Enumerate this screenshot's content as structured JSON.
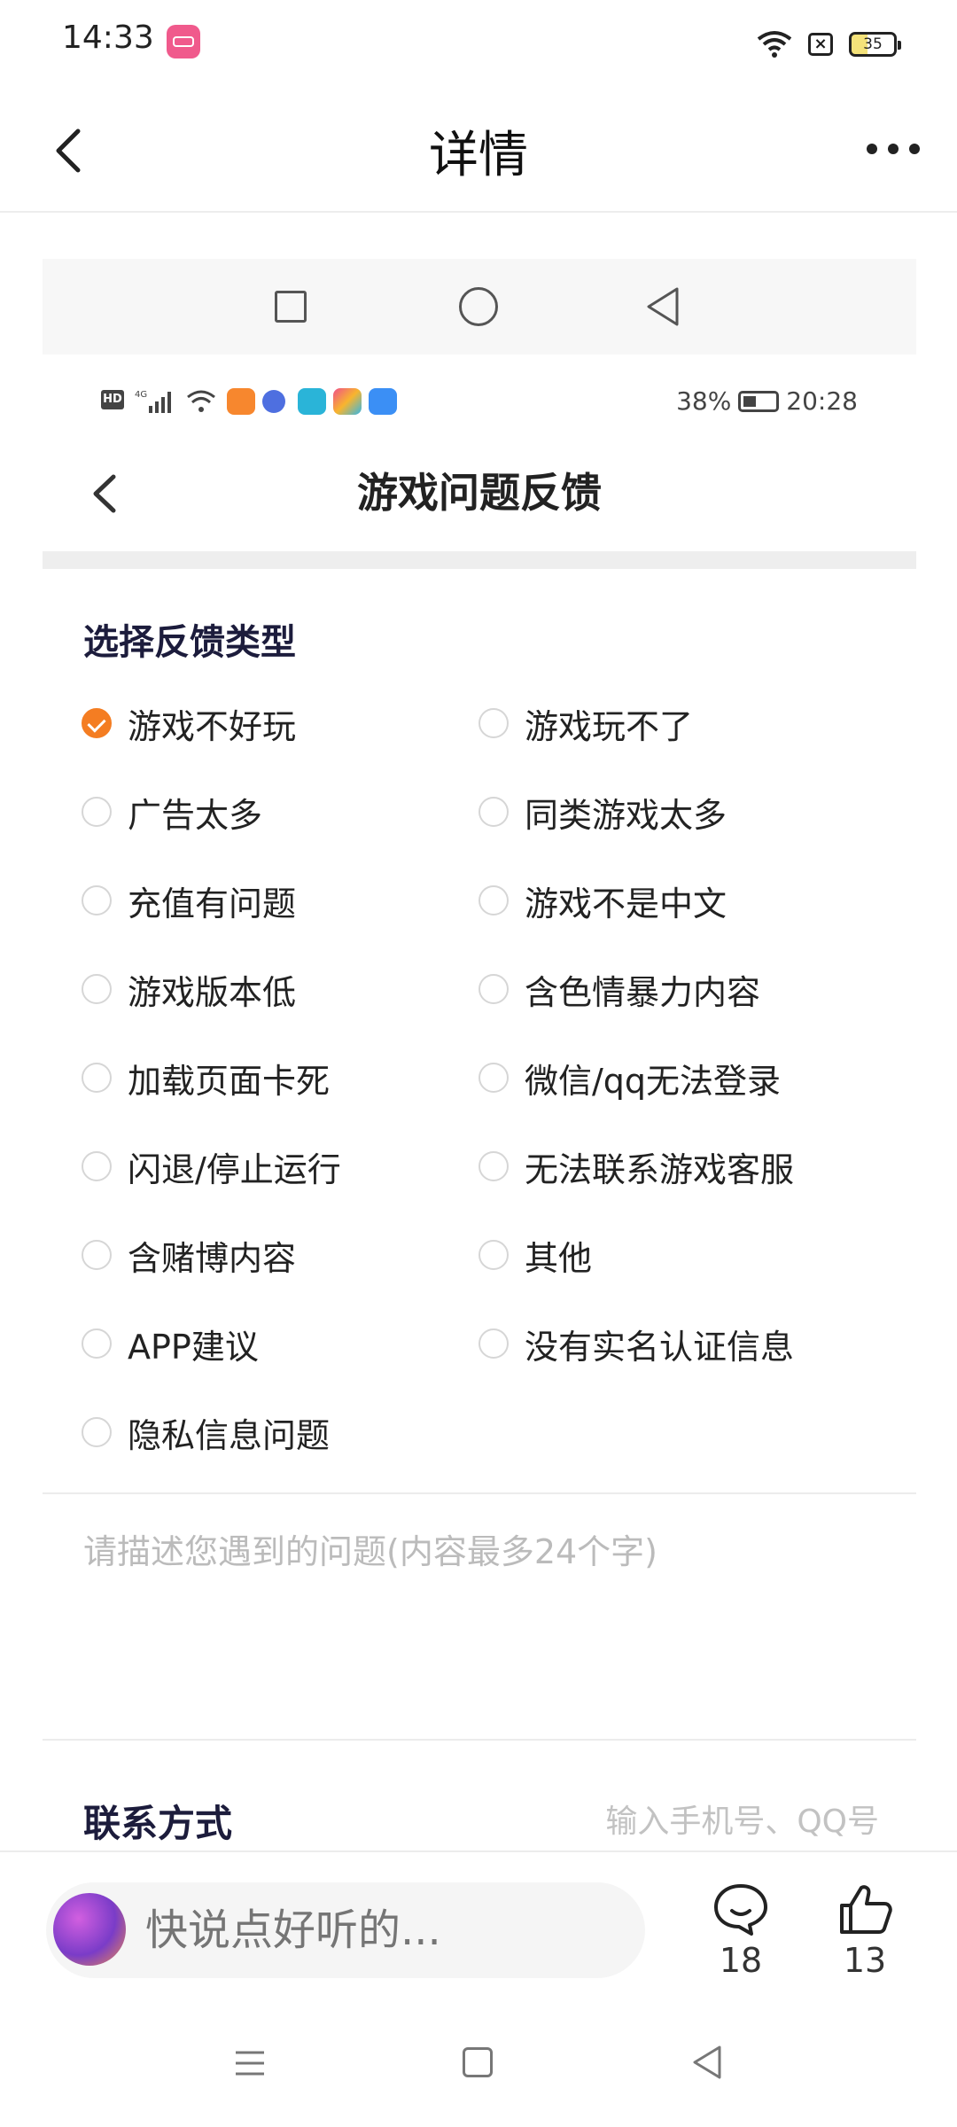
{
  "status_bar": {
    "time": "14:33",
    "battery": "35"
  },
  "header": {
    "title": "详情"
  },
  "embedded": {
    "status_bar": {
      "battery_pct": "38%",
      "time": "20:28"
    },
    "header": {
      "title": "游戏问题反馈"
    },
    "section_title": "选择反馈类型",
    "options": [
      {
        "label": "游戏不好玩",
        "checked": true
      },
      {
        "label": "游戏玩不了",
        "checked": false
      },
      {
        "label": "广告太多",
        "checked": false
      },
      {
        "label": "同类游戏太多",
        "checked": false
      },
      {
        "label": "充值有问题",
        "checked": false
      },
      {
        "label": "游戏不是中文",
        "checked": false
      },
      {
        "label": "游戏版本低",
        "checked": false
      },
      {
        "label": "含色情暴力内容",
        "checked": false
      },
      {
        "label": "加载页面卡死",
        "checked": false
      },
      {
        "label": "微信/qq无法登录",
        "checked": false
      },
      {
        "label": "闪退/停止运行",
        "checked": false
      },
      {
        "label": "无法联系游戏客服",
        "checked": false
      },
      {
        "label": "含赌博内容",
        "checked": false
      },
      {
        "label": "其他",
        "checked": false
      },
      {
        "label": "APP建议",
        "checked": false
      },
      {
        "label": "没有实名认证信息",
        "checked": false
      },
      {
        "label": "隐私信息问题",
        "checked": false
      }
    ],
    "description_placeholder": "请描述您遇到的问题(内容最多24个字)",
    "contact": {
      "label": "联系方式",
      "placeholder": "输入手机号、QQ号"
    }
  },
  "bottom_bar": {
    "comment_placeholder": "快说点好听的...",
    "comment_count": "18",
    "like_count": "13"
  },
  "colors": {
    "accent": "#f47d22",
    "bili_pink": "#f05a8c"
  }
}
